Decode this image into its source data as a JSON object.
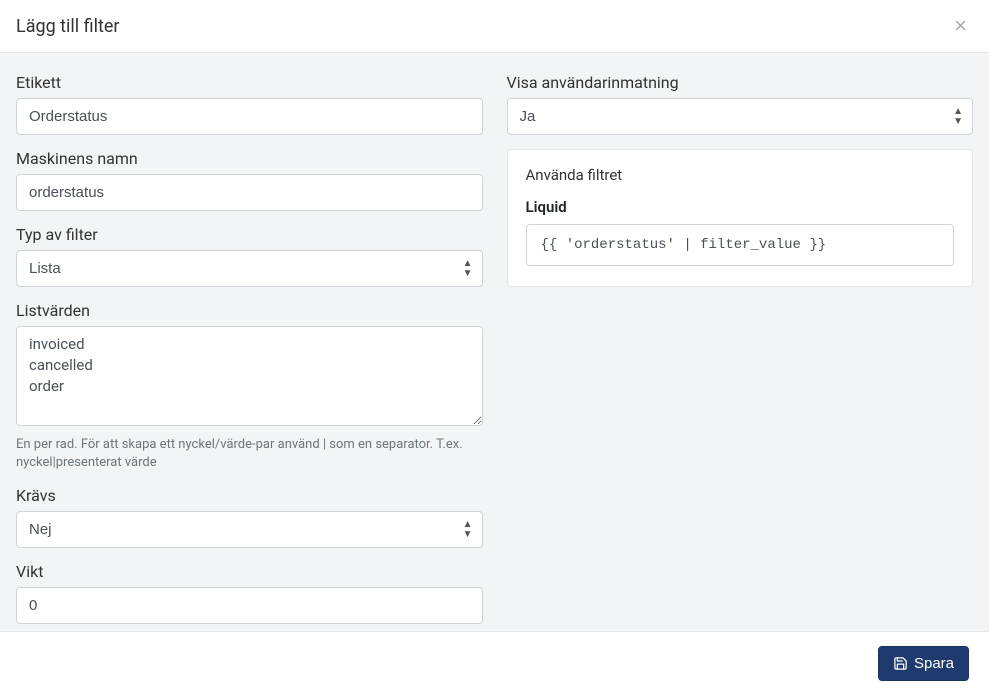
{
  "modal": {
    "title": "Lägg till filter",
    "close_symbol": "×"
  },
  "left": {
    "etikett": {
      "label": "Etikett",
      "value": "Orderstatus"
    },
    "maskin": {
      "label": "Maskinens namn",
      "value": "orderstatus"
    },
    "typ": {
      "label": "Typ av filter",
      "value": "Lista"
    },
    "listvarden": {
      "label": "Listvärden",
      "value": "invoiced\ncancelled\norder",
      "help": "En per rad. För att skapa ett nyckel/värde-par använd | som en separator. T.ex. nyckel|presenterat värde"
    },
    "kravs": {
      "label": "Krävs",
      "value": "Nej"
    },
    "vikt": {
      "label": "Vikt",
      "value": "0"
    }
  },
  "right": {
    "visa": {
      "label": "Visa användarinmatning",
      "value": "Ja"
    },
    "card": {
      "title": "Använda filtret",
      "subtitle": "Liquid",
      "code": "{{ 'orderstatus' | filter_value }}"
    }
  },
  "footer": {
    "save": "Spara"
  }
}
